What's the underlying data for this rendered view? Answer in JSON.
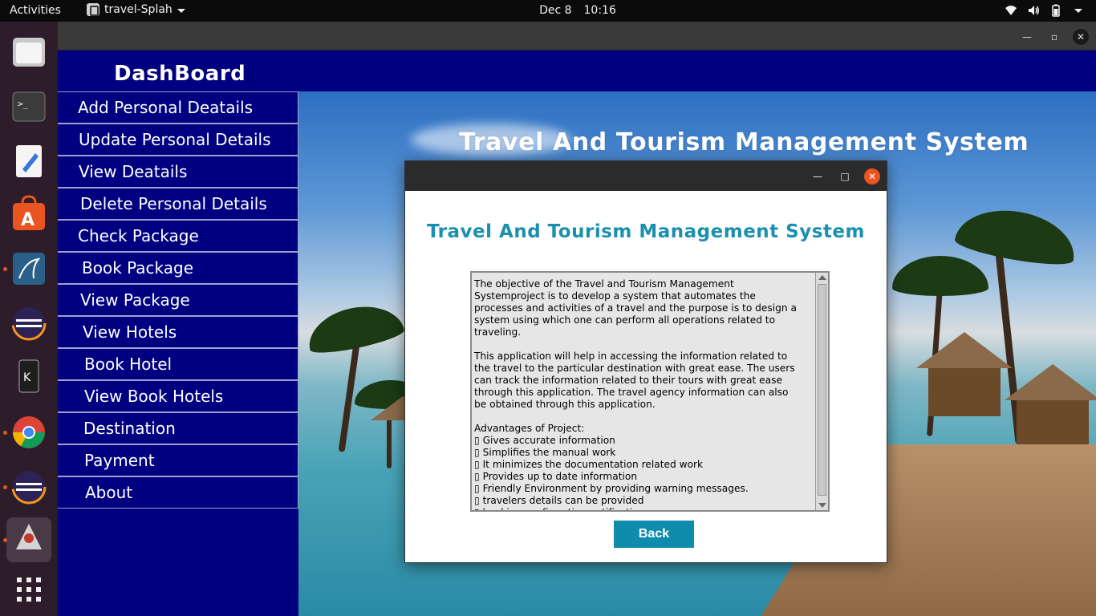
{
  "topbar": {
    "activities": "Activities",
    "app_name": "travel-Splah",
    "date": "Dec 8",
    "time": "10:16"
  },
  "dock": {
    "icons": [
      "files-icon",
      "terminal-icon",
      "text-editor-icon",
      "app-store-icon",
      "mysql-workbench-icon",
      "eclipse-icon",
      "kde-connect-icon",
      "chrome-icon",
      "eclipse-icon-2",
      "java-icon",
      "show-apps-icon"
    ]
  },
  "sidebar": {
    "title": "DashBoard",
    "items": [
      {
        "label": "Add Personal Deatails"
      },
      {
        "label": "Update Personal Details"
      },
      {
        "label": "View Deatails"
      },
      {
        "label": "Delete Personal Details"
      },
      {
        "label": "Check Package"
      },
      {
        "label": "Book Package"
      },
      {
        "label": "View Package"
      },
      {
        "label": "View Hotels"
      },
      {
        "label": "Book Hotel"
      },
      {
        "label": "View Book Hotels"
      },
      {
        "label": "Destination"
      },
      {
        "label": "Payment"
      },
      {
        "label": "About"
      }
    ]
  },
  "main": {
    "title": "Travel And Tourism Management System"
  },
  "dialog": {
    "heading": "Travel And Tourism Management System",
    "body": "The objective of the Travel and Tourism Management\nSystemproject is to develop a system that automates the\nprocesses and activities of a travel and the purpose is to design a\nsystem using which one can perform all operations related to\ntraveling.\n\nThis application will help in accessing the information related to\nthe travel to the particular destination with great ease. The users\ncan track the information related to their tours with great ease\nthrough this application. The travel agency information can also\nbe obtained through this application.\n\nAdvantages of Project:\n▯ Gives accurate information\n▯ Simplifies the manual work\n▯ It minimizes the documentation related work\n▯ Provides up to date information\n▯ Friendly Environment by providing warning messages.\n▯ travelers details can be provided\n▯ booking confirmation notification",
    "back_label": "Back"
  },
  "colors": {
    "sidebar_bg": "#000080",
    "dialog_heading": "#1a8fb0",
    "back_button": "#0f8bab",
    "close_button": "#e95420"
  }
}
